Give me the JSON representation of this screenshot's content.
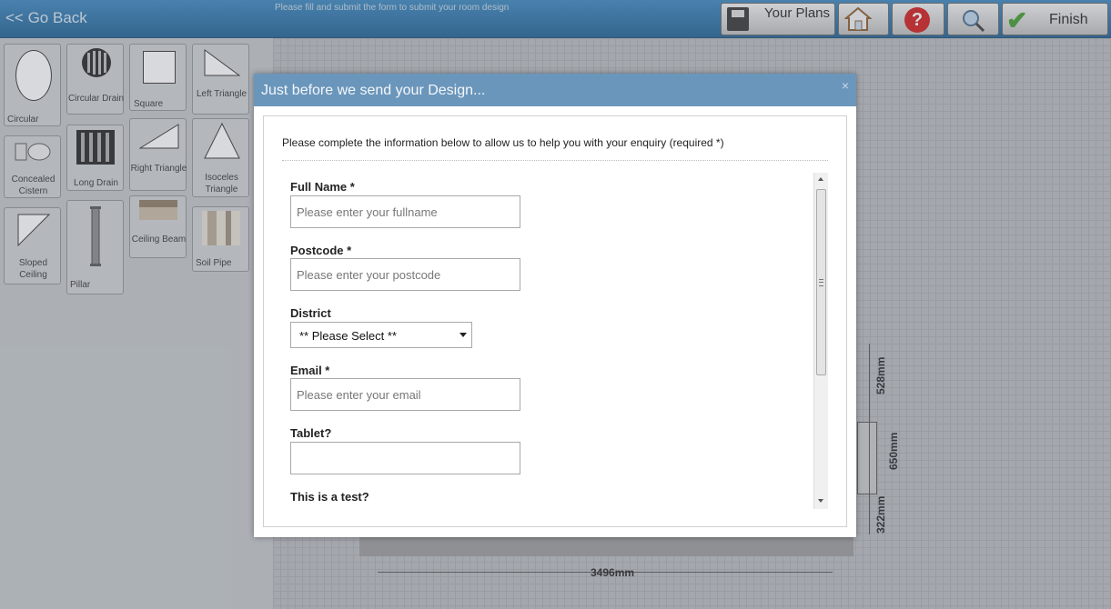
{
  "topbar": {
    "go_back": "<< Go Back",
    "instructions": "Please fill and submit the form to submit your room design",
    "your_plans": "Your Plans",
    "finish": "Finish",
    "help_glyph": "?"
  },
  "palette": [
    {
      "label": "Circular",
      "icon": "oval-shape-icon"
    },
    {
      "label": "Circular Drain",
      "icon": "circular-drain-icon"
    },
    {
      "label": "Square",
      "icon": "square-shape-icon"
    },
    {
      "label": "Left Triangle",
      "icon": "left-triangle-icon"
    },
    {
      "label": "Concealed Cistern",
      "icon": "cistern-icon"
    },
    {
      "label": "Long Drain",
      "icon": "long-drain-icon"
    },
    {
      "label": "Right Triangle",
      "icon": "right-triangle-icon"
    },
    {
      "label": "Isoceles Triangle",
      "icon": "isoceles-triangle-icon"
    },
    {
      "label": "Sloped Ceiling",
      "icon": "sloped-ceiling-icon"
    },
    {
      "label": "Pillar",
      "icon": "pillar-icon"
    },
    {
      "label": "Ceiling Beam",
      "icon": "ceiling-beam-icon"
    },
    {
      "label": "Soil Pipe",
      "icon": "soil-pipe-icon"
    }
  ],
  "canvas": {
    "dims": {
      "top_right": "528mm",
      "mid_right": "650mm",
      "bottom_right": "322mm",
      "width": "3496mm"
    }
  },
  "modal": {
    "title": "Just before we send your Design...",
    "close": "×",
    "intro": "Please complete the information below to allow us to help you with your enquiry (required *)",
    "fields": {
      "fullname": {
        "label": "Full Name *",
        "placeholder": "Please enter your fullname"
      },
      "postcode": {
        "label": "Postcode *",
        "placeholder": "Please enter your postcode"
      },
      "district": {
        "label": "District",
        "value": "** Please Select **"
      },
      "email": {
        "label": "Email *",
        "placeholder": "Please enter your email"
      },
      "tablet": {
        "label": "Tablet?",
        "placeholder": ""
      },
      "test": {
        "label": "This is a test?"
      }
    }
  },
  "colors": {
    "header": "#6b96bb",
    "topbar": "#2a72a9",
    "finish_check": "#3f9b2b",
    "help": "#d21818"
  }
}
